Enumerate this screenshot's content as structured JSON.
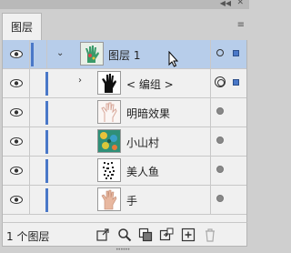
{
  "tab": {
    "label": "图层"
  },
  "layers": [
    {
      "name": "图层 1",
      "expanded": true,
      "selected": true,
      "visible": true,
      "target": "single",
      "selection_square": true
    },
    {
      "name": "< 编组 >",
      "expanded": false,
      "selected": false,
      "visible": true,
      "target": "double",
      "selection_square": true
    },
    {
      "name": "明暗效果",
      "visible": true,
      "target": "filled"
    },
    {
      "name": "小山村",
      "visible": true,
      "target": "filled"
    },
    {
      "name": "美人鱼",
      "visible": true,
      "target": "filled"
    },
    {
      "name": "手",
      "visible": true,
      "target": "filled"
    }
  ],
  "footer": {
    "layer_count": "1 个图层"
  },
  "colors": {
    "selection": "#b7cdea",
    "layer_color": "#4a78c8",
    "panel_bg": "#f0f0f0"
  },
  "icons": [
    "eye-icon",
    "expand-arrow-icon",
    "export-icon",
    "search-icon",
    "make-clipping-mask-icon",
    "new-sublayer-icon",
    "new-layer-icon",
    "trash-icon",
    "panel-menu-icon",
    "collapse-panel-icon",
    "close-icon"
  ]
}
